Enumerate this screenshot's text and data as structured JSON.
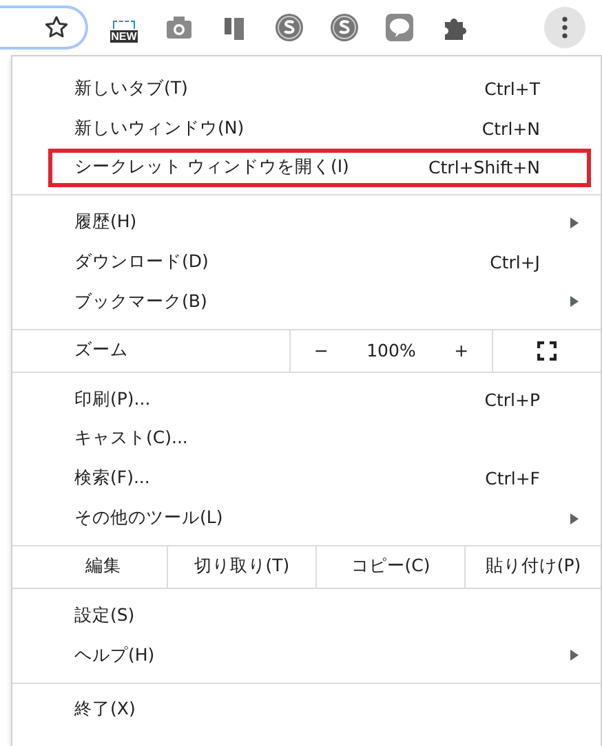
{
  "toolbar": {
    "icons": [
      {
        "kind": "new-badge",
        "text": "NEW"
      },
      {
        "kind": "camera"
      },
      {
        "kind": "panels"
      },
      {
        "kind": "s-coin"
      },
      {
        "kind": "s-coin"
      },
      {
        "kind": "chat"
      },
      {
        "kind": "puzzle"
      }
    ]
  },
  "menu": {
    "sections": [
      {
        "items": [
          {
            "kind": "item",
            "label": "新しいタブ(T)",
            "shortcut": "Ctrl+T",
            "submenu": false,
            "highlighted": false
          },
          {
            "kind": "item",
            "label": "新しいウィンドウ(N)",
            "shortcut": "Ctrl+N",
            "submenu": false,
            "highlighted": false
          },
          {
            "kind": "item",
            "label": "シークレット ウィンドウを開く(I)",
            "shortcut": "Ctrl+Shift+N",
            "submenu": false,
            "highlighted": true
          }
        ]
      },
      {
        "items": [
          {
            "kind": "item",
            "label": "履歴(H)",
            "submenu": true,
            "highlighted": false
          },
          {
            "kind": "item",
            "label": "ダウンロード(D)",
            "shortcut": "Ctrl+J",
            "submenu": false,
            "highlighted": false
          },
          {
            "kind": "item",
            "label": "ブックマーク(B)",
            "submenu": true,
            "highlighted": false
          }
        ]
      },
      {
        "items": [
          {
            "kind": "zoom",
            "label": "ズーム",
            "minus": "−",
            "value": "100%",
            "plus": "+"
          }
        ]
      },
      {
        "items": [
          {
            "kind": "item",
            "label": "印刷(P)...",
            "shortcut": "Ctrl+P",
            "submenu": false,
            "highlighted": false
          },
          {
            "kind": "item",
            "label": "キャスト(C)...",
            "submenu": false,
            "highlighted": false
          },
          {
            "kind": "item",
            "label": "検索(F)...",
            "shortcut": "Ctrl+F",
            "submenu": false,
            "highlighted": false
          },
          {
            "kind": "item",
            "label": "その他のツール(L)",
            "submenu": true,
            "highlighted": false
          }
        ]
      },
      {
        "items": [
          {
            "kind": "edit",
            "label": "編集",
            "buttons": [
              "切り取り(T)",
              "コピー(C)",
              "貼り付け(P)"
            ]
          }
        ]
      },
      {
        "items": [
          {
            "kind": "item",
            "label": "設定(S)",
            "submenu": false,
            "highlighted": false
          },
          {
            "kind": "item",
            "label": "ヘルプ(H)",
            "submenu": true,
            "highlighted": false
          }
        ]
      },
      {
        "items": [
          {
            "kind": "item",
            "label": "終了(X)",
            "submenu": false,
            "highlighted": false
          }
        ]
      }
    ]
  }
}
